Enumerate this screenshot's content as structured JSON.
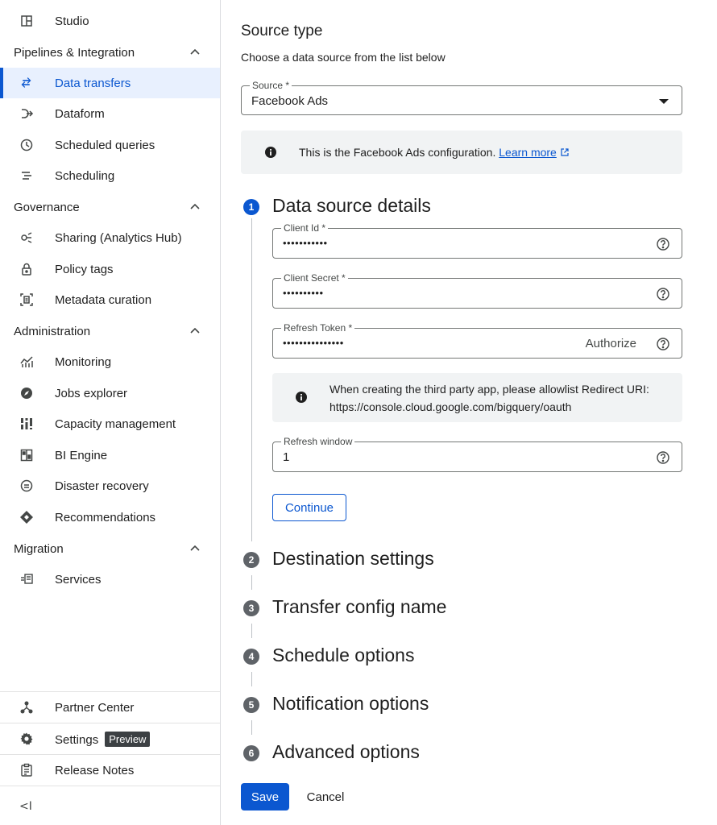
{
  "sidebar": {
    "studio": "Studio",
    "sections": {
      "pipelines": "Pipelines & Integration",
      "governance": "Governance",
      "administration": "Administration",
      "migration": "Migration"
    },
    "items": {
      "data_transfers": "Data transfers",
      "dataform": "Dataform",
      "scheduled_queries": "Scheduled queries",
      "scheduling": "Scheduling",
      "sharing": "Sharing (Analytics Hub)",
      "policy_tags": "Policy tags",
      "metadata_curation": "Metadata curation",
      "monitoring": "Monitoring",
      "jobs_explorer": "Jobs explorer",
      "capacity_management": "Capacity management",
      "bi_engine": "BI Engine",
      "disaster_recovery": "Disaster recovery",
      "recommendations": "Recommendations",
      "services": "Services"
    },
    "bottom": {
      "partner_center": "Partner Center",
      "settings": "Settings",
      "settings_badge": "Preview",
      "release_notes": "Release Notes",
      "collapse": "<I"
    }
  },
  "main": {
    "source_type_title": "Source type",
    "source_type_subtitle": "Choose a data source from the list below",
    "source_field": {
      "label": "Source *",
      "value": "Facebook Ads"
    },
    "config_info": {
      "text": "This is the Facebook Ads configuration.",
      "link": "Learn more"
    },
    "steps": [
      {
        "number": "1",
        "title": "Data source details"
      },
      {
        "number": "2",
        "title": "Destination settings"
      },
      {
        "number": "3",
        "title": "Transfer config name"
      },
      {
        "number": "4",
        "title": "Schedule options"
      },
      {
        "number": "5",
        "title": "Notification options"
      },
      {
        "number": "6",
        "title": "Advanced options"
      }
    ],
    "fields": {
      "client_id": {
        "label": "Client Id *",
        "value": "•••••••••••"
      },
      "client_secret": {
        "label": "Client Secret *",
        "value": "••••••••••"
      },
      "refresh_token": {
        "label": "Refresh Token *",
        "value": "•••••••••••••••",
        "action": "Authorize"
      },
      "refresh_window": {
        "label": "Refresh window",
        "value": "1"
      }
    },
    "redirect_info": {
      "line1": "When creating the third party app, please allowlist Redirect URI:",
      "line2": "https://console.cloud.google.com/bigquery/oauth"
    },
    "continue_label": "Continue",
    "save_label": "Save",
    "cancel_label": "Cancel"
  },
  "colors": {
    "accent": "#0b57d0",
    "active_bg": "#e8f0fe",
    "info_bg": "#f1f3f4",
    "step_inactive": "#5f6368"
  }
}
